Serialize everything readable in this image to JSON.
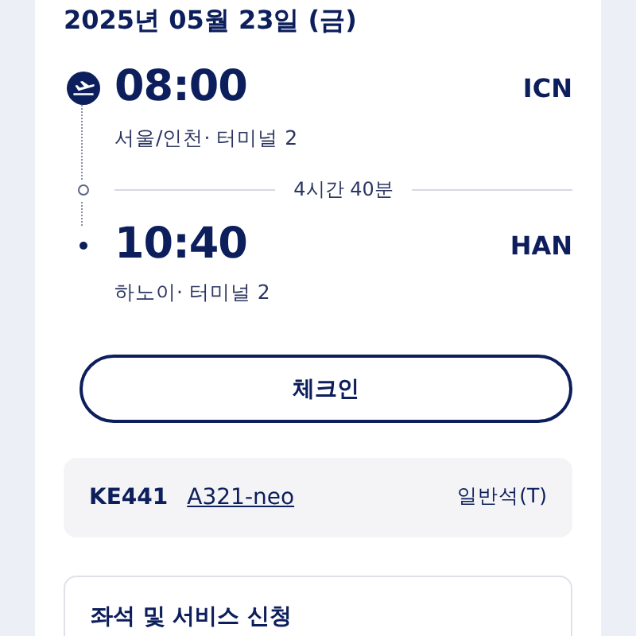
{
  "date": "2025년 05월 23일 (금)",
  "departure": {
    "time": "08:00",
    "code": "ICN",
    "place": "서울/인천· 터미널  2"
  },
  "duration": "4시간 40분",
  "arrival": {
    "time": "10:40",
    "code": "HAN",
    "place": "하노이· 터미널  2"
  },
  "checkin_button": "체크인",
  "flight": {
    "number": "KE441",
    "aircraft": "A321-neo",
    "cabin": "일반석(T)"
  },
  "services": {
    "title": "좌석 및 서비스 신청"
  }
}
